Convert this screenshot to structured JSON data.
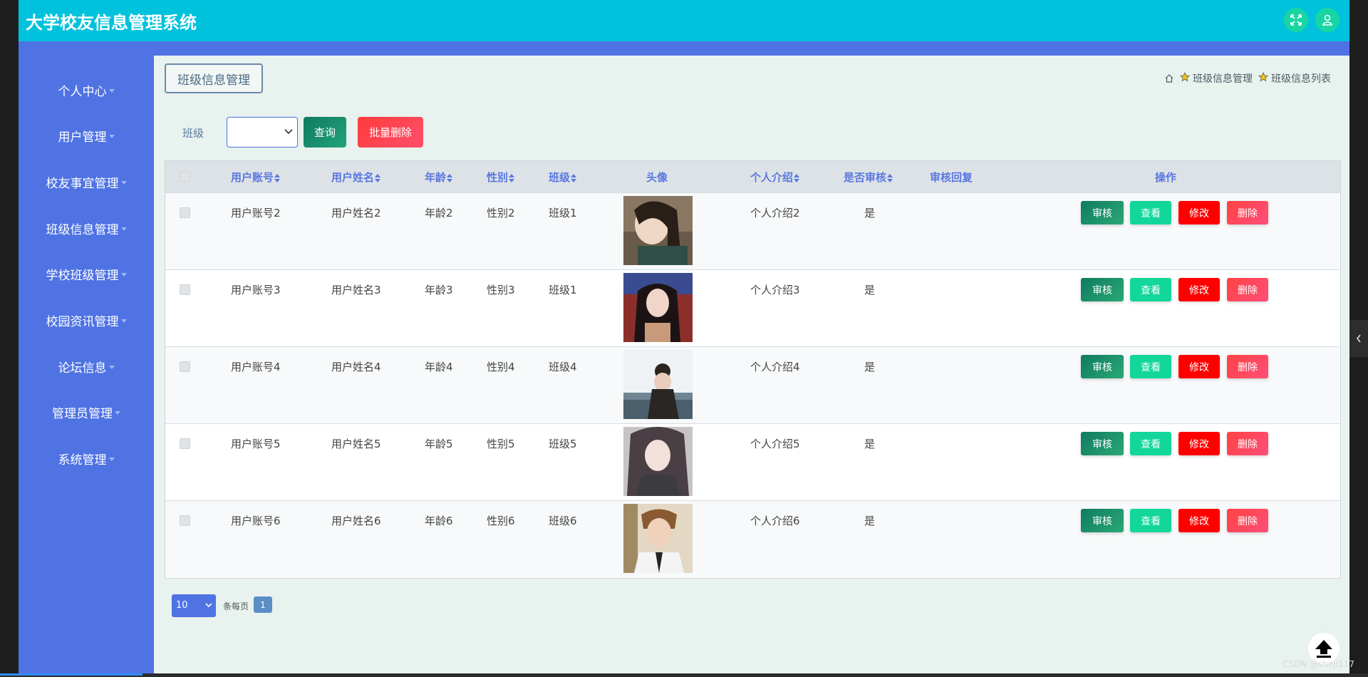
{
  "app": {
    "title": "大学校友信息管理系统"
  },
  "sidebar": {
    "items": [
      {
        "label": "个人中心"
      },
      {
        "label": "用户管理"
      },
      {
        "label": "校友事宜管理"
      },
      {
        "label": "班级信息管理"
      },
      {
        "label": "学校班级管理"
      },
      {
        "label": "校园资讯管理"
      },
      {
        "label": "论坛信息"
      },
      {
        "label": "管理员管理"
      },
      {
        "label": "系统管理"
      }
    ]
  },
  "page": {
    "tag": "班级信息管理",
    "breadcrumb": [
      "班级信息管理",
      "班级信息列表"
    ]
  },
  "filter": {
    "label": "班级",
    "selected": "",
    "query_label": "查询",
    "batch_delete_label": "批量删除"
  },
  "table": {
    "headers": {
      "account": "用户账号",
      "name": "用户姓名",
      "age": "年龄",
      "gender": "性别",
      "class": "班级",
      "avatar": "头像",
      "intro": "个人介绍",
      "reviewed": "是否审核",
      "reply": "审核回复",
      "actions": "操作"
    },
    "rows": [
      {
        "account": "用户账号2",
        "name": "用户姓名2",
        "age": "年龄2",
        "gender": "性别2",
        "class": "班级1",
        "intro": "个人介绍2",
        "reviewed": "是",
        "reply": ""
      },
      {
        "account": "用户账号3",
        "name": "用户姓名3",
        "age": "年龄3",
        "gender": "性别3",
        "class": "班级1",
        "intro": "个人介绍3",
        "reviewed": "是",
        "reply": ""
      },
      {
        "account": "用户账号4",
        "name": "用户姓名4",
        "age": "年龄4",
        "gender": "性别4",
        "class": "班级4",
        "intro": "个人介绍4",
        "reviewed": "是",
        "reply": ""
      },
      {
        "account": "用户账号5",
        "name": "用户姓名5",
        "age": "年龄5",
        "gender": "性别5",
        "class": "班级5",
        "intro": "个人介绍5",
        "reviewed": "是",
        "reply": ""
      },
      {
        "account": "用户账号6",
        "name": "用户姓名6",
        "age": "年龄6",
        "gender": "性别6",
        "class": "班级6",
        "intro": "个人介绍6",
        "reviewed": "是",
        "reply": ""
      }
    ],
    "actions": {
      "audit": "审核",
      "view": "查看",
      "edit": "修改",
      "delete": "删除"
    }
  },
  "pagination": {
    "page_size": "10",
    "per_page_label": "条每页",
    "current_page": "1"
  },
  "watermark": "CSDN @sheji117",
  "colors": {
    "header": "#00c2dc",
    "sidebar": "#4f73e3",
    "content_bg": "#e8f2ee"
  }
}
